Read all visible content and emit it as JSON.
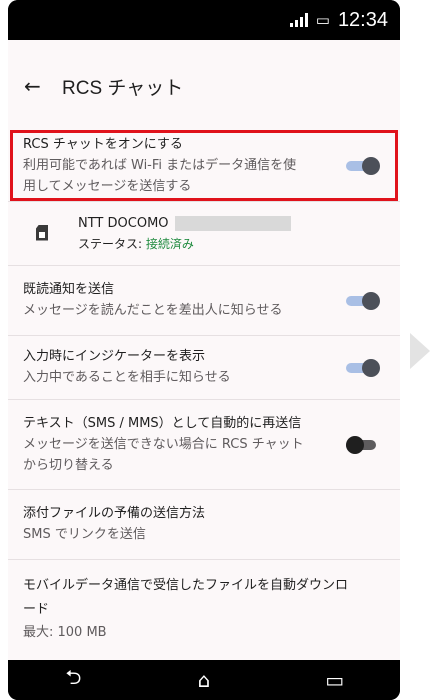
{
  "statusbar": {
    "time": "12:34",
    "battery_glyph": "▭"
  },
  "header": {
    "back_glyph": "←",
    "title": "RCS チャット"
  },
  "rcs_toggle": {
    "title": "RCS チャットをオンにする",
    "summary_line1": "利用可能であれば Wi-Fi またはデータ通信を使",
    "summary_line2": "用してメッセージを送信する",
    "state": "on"
  },
  "sim": {
    "carrier": "NTT DOCOMO",
    "status_label": "ステータス: ",
    "status_value": "接続済み"
  },
  "read_receipts": {
    "title": "既読通知を送信",
    "summary": "メッセージを読んだことを差出人に知らせる",
    "state": "on"
  },
  "typing_indicator": {
    "title": "入力時にインジケーターを表示",
    "summary": "入力中であることを相手に知らせる",
    "state": "on"
  },
  "resend_sms": {
    "title": "テキスト（SMS / MMS）として自動的に再送信",
    "summary_line1": "メッセージを送信できない場合に RCS チャット",
    "summary_line2": "から切り替える",
    "state": "off"
  },
  "fallback": {
    "title": "添付ファイルの予備の送信方法",
    "summary": "SMS でリンクを送信"
  },
  "auto_download": {
    "title_line1": "モバイルデータ通信で受信したファイルを自動ダウンロ",
    "title_line2": "ード",
    "summary": "最大: 100 MB"
  },
  "navbar": {
    "back_glyph": "⮌",
    "home_glyph": "⌂",
    "recents_glyph": "▭"
  },
  "colors": {
    "highlight": "#e0121b",
    "connected": "#1e8a3e",
    "toggle_on_thumb": "#4c5059"
  }
}
